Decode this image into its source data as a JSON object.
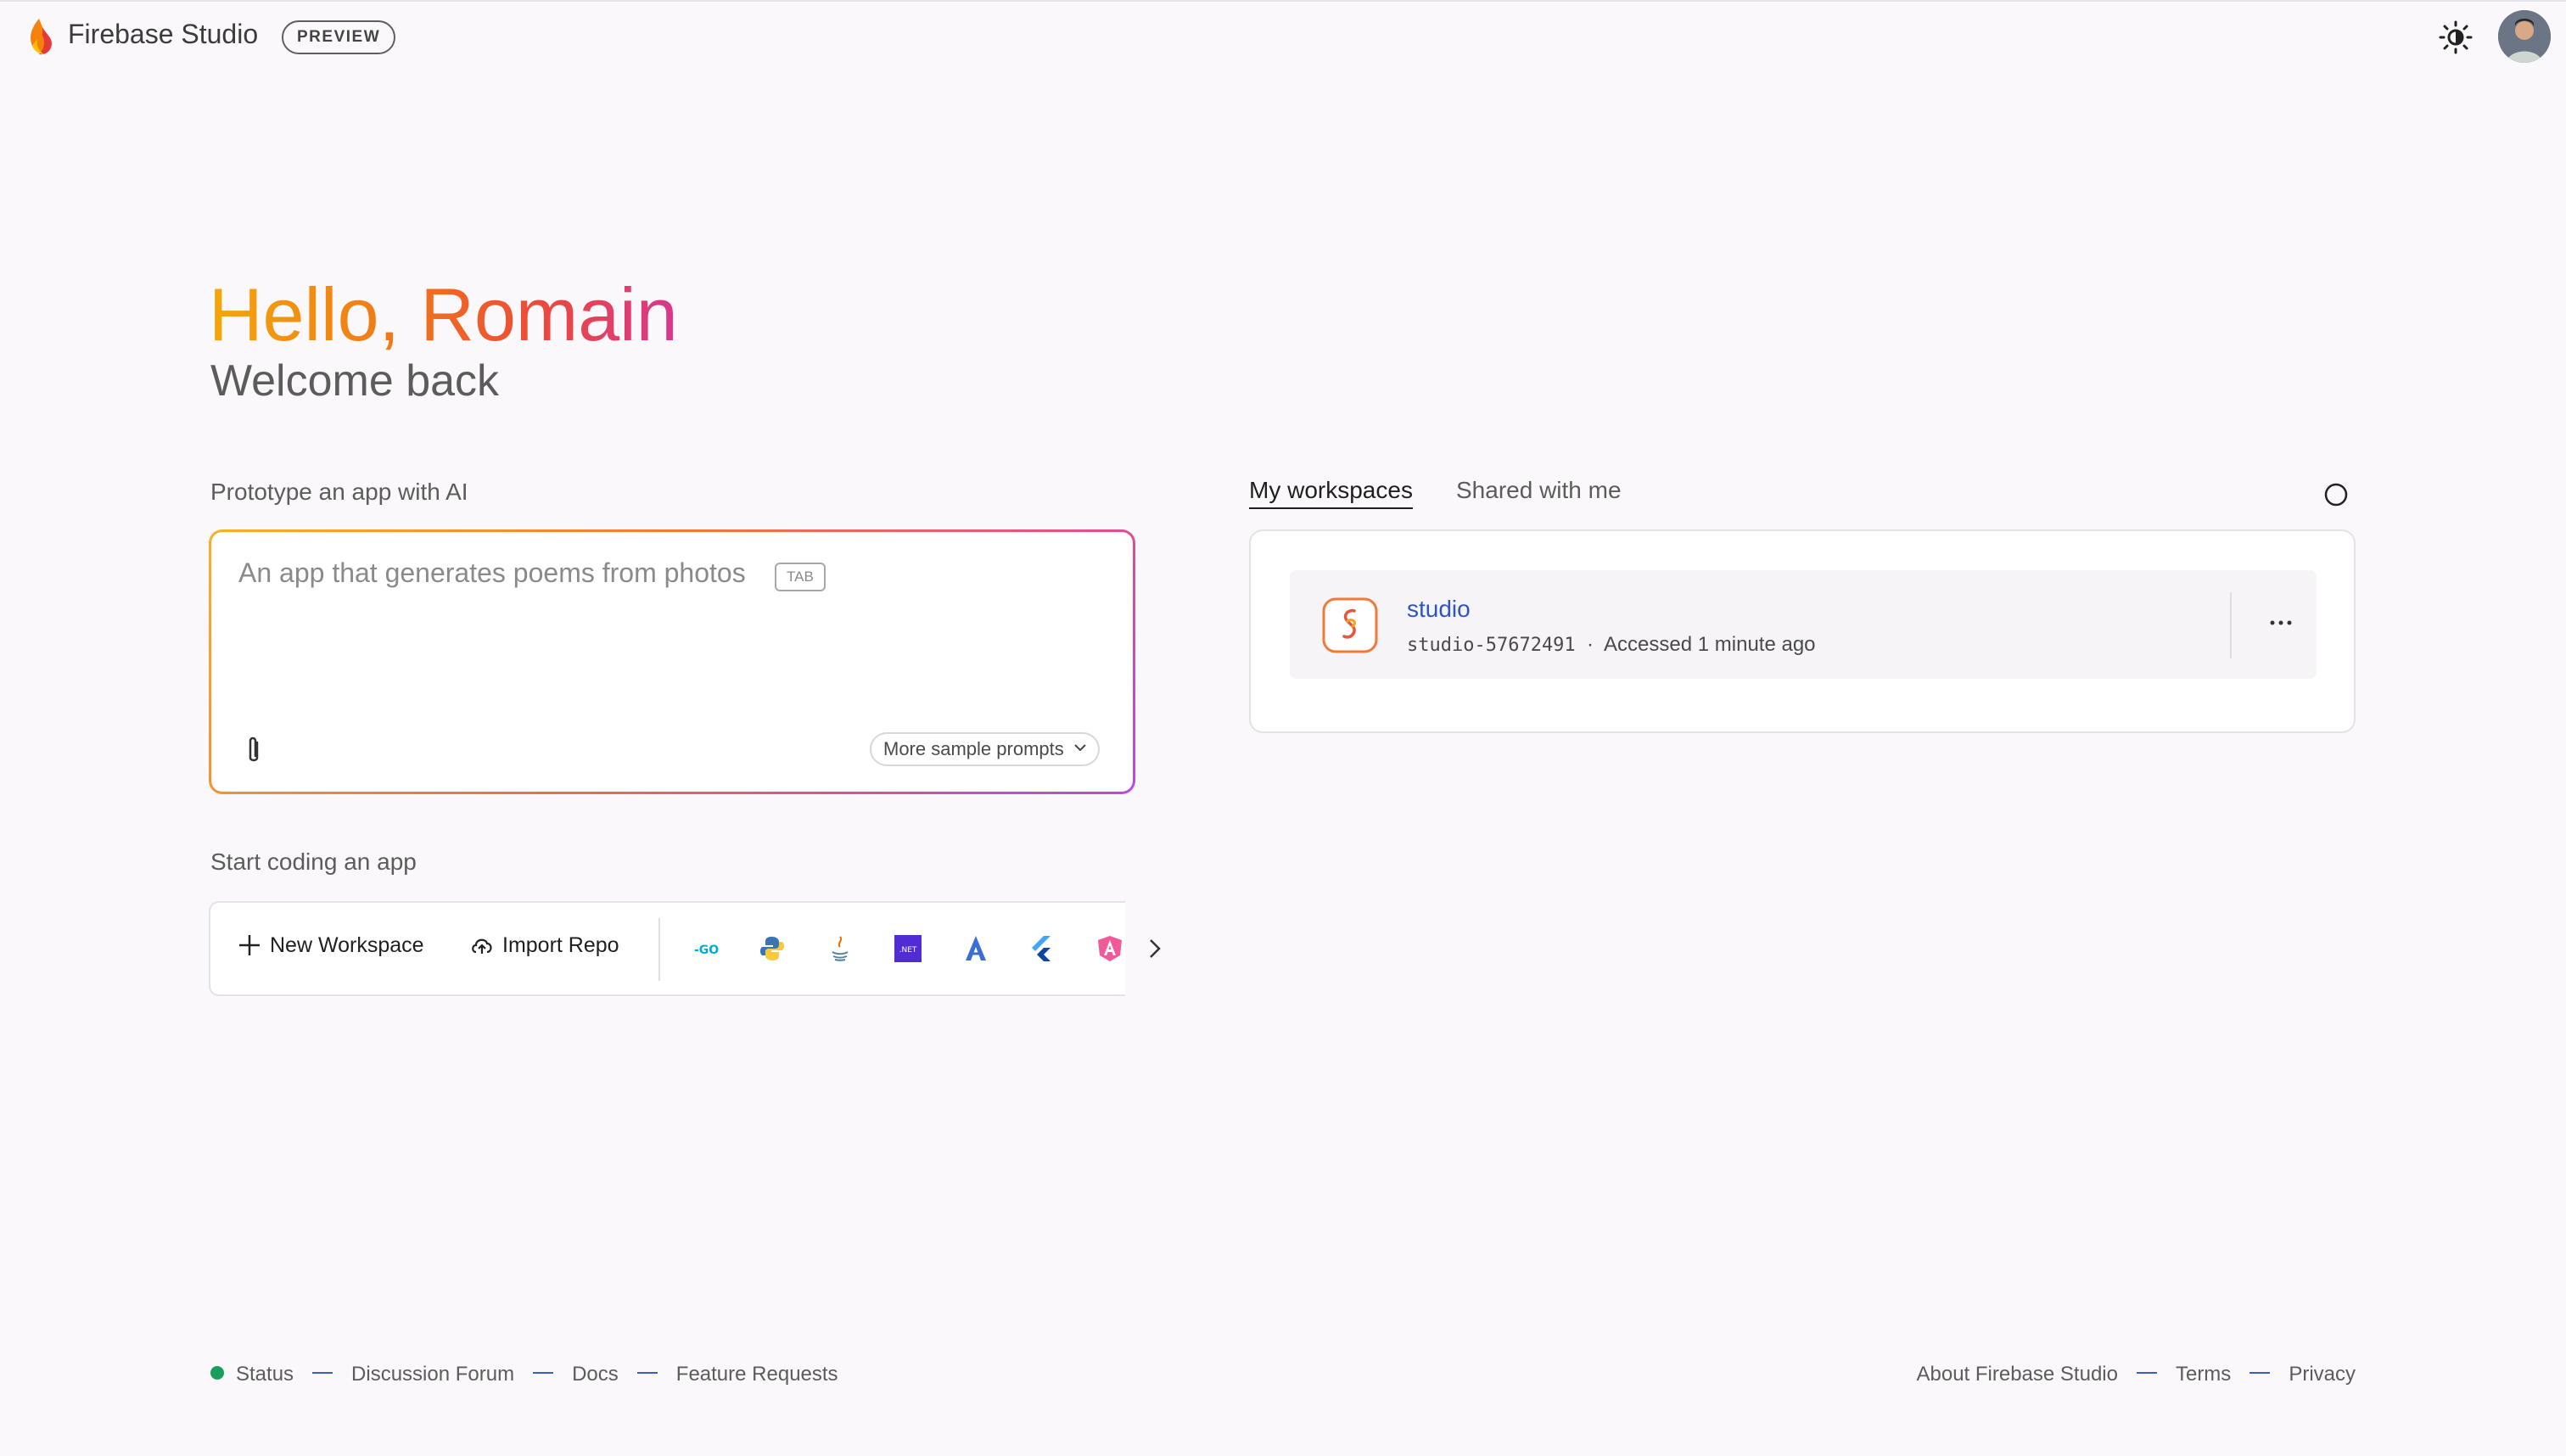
{
  "header": {
    "brand": "Firebase Studio",
    "badge": "PREVIEW"
  },
  "greeting": {
    "hello": "Hello, Romain",
    "welcome": "Welcome back"
  },
  "prototype": {
    "label": "Prototype an app with AI",
    "placeholder": "An app that generates poems from photos",
    "tab_hint": "TAB",
    "sample_prompts": "More sample prompts"
  },
  "coding": {
    "label": "Start coding an app",
    "new_workspace": "New Workspace",
    "import_repo": "Import Repo",
    "templates": [
      "go-icon",
      "python-icon",
      "java-icon",
      "dotnet-icon",
      "angular-alt-icon",
      "flutter-icon",
      "angular-icon"
    ],
    "dotnet_text": ".NET"
  },
  "workspaces": {
    "tabs": [
      "My workspaces",
      "Shared with me"
    ],
    "items": [
      {
        "name": "studio",
        "id": "studio-57672491",
        "accessed": "Accessed 1 minute ago"
      }
    ]
  },
  "footer": {
    "left": [
      "Status",
      "Discussion Forum",
      "Docs",
      "Feature Requests"
    ],
    "right": [
      "About Firebase Studio",
      "Terms",
      "Privacy"
    ]
  },
  "colors": {
    "accent_link": "#2f54c4",
    "status_ok": "#1a9e5c"
  }
}
